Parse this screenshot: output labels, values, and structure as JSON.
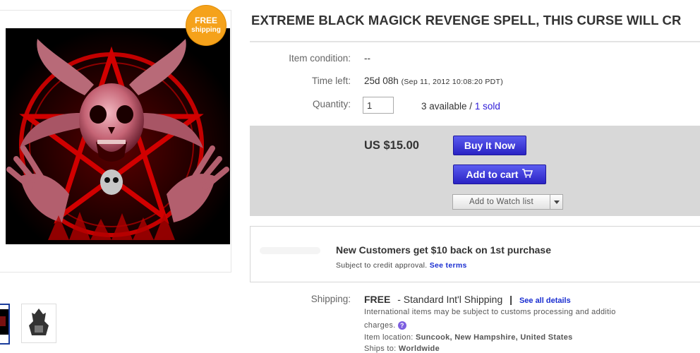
{
  "listing": {
    "title": "EXTREME BLACK MAGICK REVENGE SPELL, THIS CURSE WILL CR",
    "badge": {
      "line1": "FREE",
      "line2": "shipping"
    },
    "item_condition_label": "Item condition:",
    "item_condition_value": "--",
    "time_left_label": "Time left:",
    "time_left_value": "25d 08h",
    "time_left_date": "(Sep 11, 2012 10:08:20 PDT)",
    "quantity_label": "Quantity:",
    "quantity_value": "1",
    "available_text": "3 available /",
    "sold_text": "1 sold",
    "price": "US $15.00",
    "buy_now_label": "Buy It Now",
    "add_to_cart_label": "Add to cart",
    "watch_label": "Add to Watch list"
  },
  "promo": {
    "headline": "New Customers get $10 back on 1st purchase",
    "subtext": "Subject to credit approval.",
    "link": "See terms"
  },
  "shipping": {
    "label": "Shipping:",
    "free": "FREE",
    "method": "- Standard Int'l Shipping",
    "separator": "|",
    "details_link": "See all details",
    "note_line1": "International items may be subject to customs processing and additio",
    "note_line2": "charges.",
    "location_label": "Item location:",
    "location_value": "Suncook, New Hampshire, United States",
    "ships_to_label": "Ships to:",
    "ships_to_value": "Worldwide"
  },
  "colors": {
    "accent_blue": "#2a23c4",
    "link_blue": "#1a2ed1",
    "badge_orange": "#f5a21b",
    "buy_box_gray": "#d8d8d8"
  }
}
